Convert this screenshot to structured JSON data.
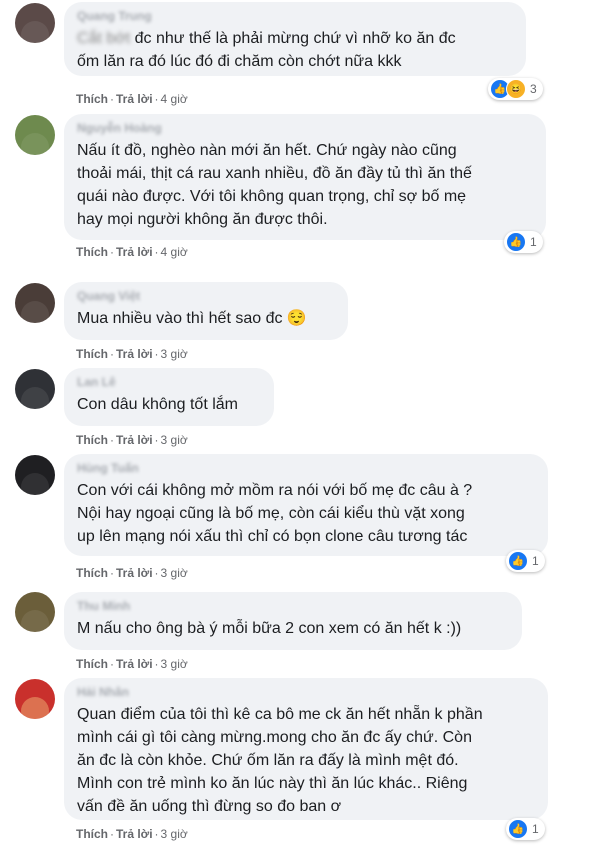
{
  "comments": [
    {
      "name": "Quang Trung",
      "text_blur": "Cắt bớt",
      "text": "đc như thế là phải mừng chứ vì nhỡ ko ăn đc\nốm lăn ra đó lúc đó đi chăm còn chớt nữa kkk",
      "like": "Thích",
      "reply": "Trả lời",
      "time": "4 giờ",
      "reactions": [
        "like-icon",
        "haha-icon"
      ],
      "reaction_count": "3"
    },
    {
      "name": "Nguyễn Hoàng",
      "text": "Nấu ít đồ, nghèo nàn mới ăn hết. Chứ ngày nào cũng\nthoải mái, thịt cá rau xanh nhiều, đồ ăn đầy tủ thì ăn thế\nquái nào được. Với tôi không quan trọng, chỉ sợ bố mẹ\nhay mọi người không ăn được thôi.",
      "like": "Thích",
      "reply": "Trả lời",
      "time": "4 giờ",
      "reactions": [
        "like-icon"
      ],
      "reaction_count": "1"
    },
    {
      "name": "Quang Việt",
      "text": "Mua nhiều vào thì hết sao đc 😌",
      "like": "Thích",
      "reply": "Trả lời",
      "time": "3 giờ"
    },
    {
      "name": "Lan Lê",
      "text": "Con dâu không tốt lắm",
      "like": "Thích",
      "reply": "Trả lời",
      "time": "3 giờ"
    },
    {
      "name": "Hùng Tuấn",
      "text": "Con với cái không mở mồm ra nói với bố mẹ đc câu à ?\nNội hay ngoại cũng là bố mẹ, còn cái kiểu thù vặt xong\nup lên mạng nói xấu thì chỉ có bọn clone câu tương tác",
      "like": "Thích",
      "reply": "Trả lời",
      "time": "3 giờ",
      "reactions": [
        "like-icon"
      ],
      "reaction_count": "1"
    },
    {
      "name": "Thu Minh",
      "text": "M nấu cho ông bà ý mỗi bữa 2 con xem có ăn hết k :))",
      "like": "Thích",
      "reply": "Trả lời",
      "time": "3 giờ"
    },
    {
      "name": "Hải Nhân",
      "text": "Quan điểm của tôi thì kê ca bô me ck ăn hết nhẵn k phần\nmình cái gì tôi càng mừng.mong cho ăn đc ấy chứ. Còn\năn đc là còn khỏe. Chứ ốm lăn ra đấy là mình mệt đó.\nMình con trẻ mình ko ăn lúc này thì ăn lúc khác.. Riêng\nvấn đề ăn uống thì đừng so đo ban ơ",
      "like": "Thích",
      "reply": "Trả lời",
      "time": "3 giờ",
      "reactions": [
        "like-icon"
      ],
      "reaction_count": "1"
    }
  ]
}
